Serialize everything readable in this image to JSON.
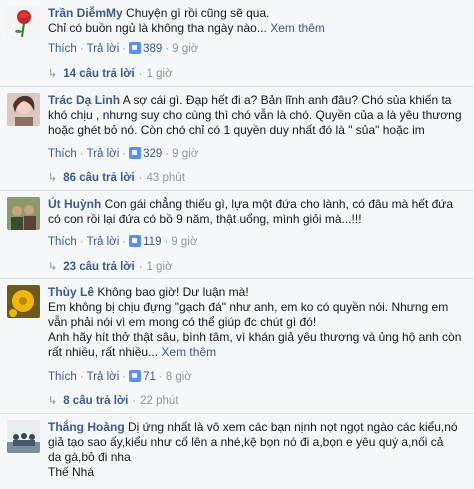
{
  "labels": {
    "like": "Thích",
    "reply": "Trả lời",
    "see_more": "Xem thêm"
  },
  "comments": [
    {
      "name": "Trần DiễmMy",
      "lines": [
        "Chuyện gì rồi cũng sẽ qua.",
        "Chỉ có buồn ngủ là không tha ngày nào"
      ],
      "ellipsis": "...",
      "likes": "389",
      "time": "9 giờ",
      "replies_label": "14 câu trả lời",
      "replies_time": "1 giờ"
    },
    {
      "name": "Trác Dạ Linh",
      "lines": [
        "A sợ cái gì. Đạp hết đi a? Bản lĩnh anh đâu? Chó sủa khiến ta",
        "khó chịu , nhưng suy cho cùng thì chó vẫn là chó. Quyền của a là yêu thương",
        "hoặc ghét bỏ nó. Còn chó chỉ có 1 quyền duy nhất đó là \" sủa\" hoặc im"
      ],
      "likes": "329",
      "time": "9 giờ",
      "replies_label": "86 câu trả lời",
      "replies_time": "43 phút"
    },
    {
      "name": "Út Huỳnh",
      "lines": [
        "Con gái chẳng thiếu gì, lựa một đứa cho lành, có đâu mà hết đứa",
        "có con rồi lại đứa có bồ 9 năm, thật uổng, mình giỏi mà...!!!"
      ],
      "likes": "119",
      "time": "9 giờ",
      "replies_label": "23 câu trả lời",
      "replies_time": "1 giờ"
    },
    {
      "name": "Thùy Lê",
      "lines": [
        "Không bao giờ! Dư luận mà!",
        "Em không bị chịu đựng \"gạch đá\" như anh, em ko có quyền nói. Nhưng em",
        "vẫn phải nói vì em mong có thể giúp đc chút gì đó!",
        "Anh hãy hít thở thật sâu, bình tâm, vì khán giả yêu thương và ủng hộ anh còn",
        "rất nhiều, rất nhiều..."
      ],
      "likes": "71",
      "time": "8 giờ",
      "replies_label": "8 câu trả lời",
      "replies_time": "22 phút"
    },
    {
      "name": "Thắng Hoàng",
      "lines": [
        "Dị ứng nhất là vô xem các bạn nịnh nọt ngọt ngào các kiểu,nó",
        "giả tạo sao ấy,kiểu như cố lên a nhé,kệ bọn nó đi a,bọn e yêu quý a,nối cả",
        "da gà,bỏ đi nha",
        "Thế Nhá"
      ]
    }
  ]
}
